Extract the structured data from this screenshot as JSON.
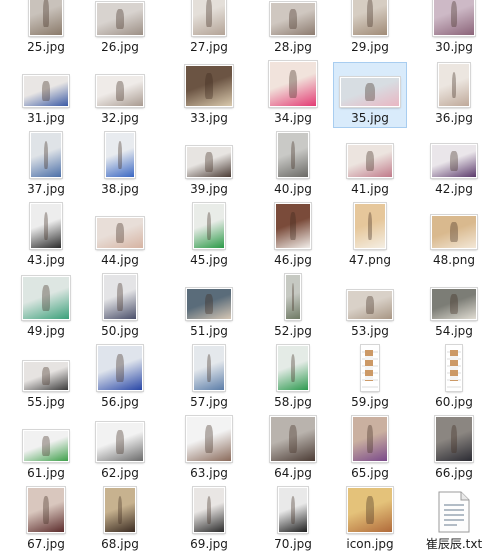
{
  "files": [
    {
      "name": "25.jpg",
      "colors": [
        "#c9c2bb",
        "#8a7a6a"
      ]
    },
    {
      "name": "26.jpg",
      "colors": [
        "#d8d3cf",
        "#9c8f85"
      ]
    },
    {
      "name": "27.jpg",
      "colors": [
        "#e4dfd9",
        "#b3a396"
      ]
    },
    {
      "name": "28.jpg",
      "colors": [
        "#cfc7c0",
        "#8c7b6f"
      ]
    },
    {
      "name": "29.jpg",
      "colors": [
        "#d6cdc2",
        "#a08b77"
      ]
    },
    {
      "name": "30.jpg",
      "colors": [
        "#cdb9c6",
        "#8b6479"
      ]
    },
    {
      "name": "31.jpg",
      "colors": [
        "#e9e6e4",
        "#3b5aa5"
      ]
    },
    {
      "name": "32.jpg",
      "colors": [
        "#efebe8",
        "#a89a90"
      ]
    },
    {
      "name": "33.jpg",
      "colors": [
        "#6b5443",
        "#d9c9ad"
      ]
    },
    {
      "name": "34.jpg",
      "colors": [
        "#f1e3dc",
        "#e33b74"
      ]
    },
    {
      "name": "35.jpg",
      "colors": [
        "#d7dde2",
        "#e9b6c2"
      ]
    },
    {
      "name": "36.jpg",
      "colors": [
        "#ece6e0",
        "#bfa99a"
      ]
    },
    {
      "name": "37.jpg",
      "colors": [
        "#dfe3e7",
        "#4b6fa8"
      ]
    },
    {
      "name": "38.jpg",
      "colors": [
        "#e8ebef",
        "#3a67c3"
      ]
    },
    {
      "name": "39.jpg",
      "colors": [
        "#e7e4e1",
        "#4a3b34"
      ]
    },
    {
      "name": "40.jpg",
      "colors": [
        "#c9c9c6",
        "#6b6a66"
      ]
    },
    {
      "name": "41.jpg",
      "colors": [
        "#ece4df",
        "#c07a8a"
      ]
    },
    {
      "name": "42.jpg",
      "colors": [
        "#eae6ea",
        "#5b3a6b"
      ]
    },
    {
      "name": "43.jpg",
      "colors": [
        "#ededed",
        "#2b2b2b"
      ]
    },
    {
      "name": "44.jpg",
      "colors": [
        "#e8ded8",
        "#d6b3a2"
      ]
    },
    {
      "name": "45.jpg",
      "colors": [
        "#e9ece8",
        "#2b9a47"
      ]
    },
    {
      "name": "46.jpg",
      "colors": [
        "#7a4b3a",
        "#f2eeea"
      ]
    },
    {
      "name": "47.png",
      "colors": [
        "#e6c79b",
        "#f4eee3"
      ]
    },
    {
      "name": "48.png",
      "colors": [
        "#d9b98e",
        "#f3e8d8"
      ]
    },
    {
      "name": "49.jpg",
      "colors": [
        "#dde6e2",
        "#3aa07a"
      ]
    },
    {
      "name": "50.jpg",
      "colors": [
        "#e4e4e6",
        "#4a4f6a"
      ]
    },
    {
      "name": "51.jpg",
      "colors": [
        "#5a6c7a",
        "#d6c7b5"
      ]
    },
    {
      "name": "52.jpg",
      "colors": [
        "#c6c9c2",
        "#6f7a65"
      ]
    },
    {
      "name": "53.jpg",
      "colors": [
        "#d9d1c8",
        "#a89684"
      ]
    },
    {
      "name": "54.jpg",
      "colors": [
        "#7c7d76",
        "#e1ddd3"
      ]
    },
    {
      "name": "55.jpg",
      "colors": [
        "#e6e3e1",
        "#3b3b3b"
      ]
    },
    {
      "name": "56.jpg",
      "colors": [
        "#dfe4ec",
        "#2846a6"
      ]
    },
    {
      "name": "57.jpg",
      "colors": [
        "#e4e8ec",
        "#5b7da8"
      ]
    },
    {
      "name": "58.jpg",
      "colors": [
        "#e4ebe6",
        "#2e9a4f"
      ]
    },
    {
      "name": "59.jpg",
      "colors": [
        "#ffffff",
        "#d06b3b"
      ],
      "doc": true
    },
    {
      "name": "60.jpg",
      "colors": [
        "#ffffff",
        "#b06b4b"
      ],
      "doc": true
    },
    {
      "name": "61.jpg",
      "colors": [
        "#f1f1f1",
        "#3ea04a"
      ]
    },
    {
      "name": "62.jpg",
      "colors": [
        "#f2f2f2",
        "#6a6a6a"
      ]
    },
    {
      "name": "63.jpg",
      "colors": [
        "#f3f3f3",
        "#8a6a5a"
      ]
    },
    {
      "name": "64.jpg",
      "colors": [
        "#b9b3ad",
        "#4b3b34"
      ]
    },
    {
      "name": "65.jpg",
      "colors": [
        "#cab0a0",
        "#7a4a8a"
      ]
    },
    {
      "name": "66.jpg",
      "colors": [
        "#8b8681",
        "#2b2b33"
      ]
    },
    {
      "name": "67.jpg",
      "colors": [
        "#d9c7be",
        "#5b2b2b"
      ]
    },
    {
      "name": "68.jpg",
      "colors": [
        "#c7b28f",
        "#3a2b22"
      ]
    },
    {
      "name": "69.jpg",
      "colors": [
        "#e9e6e4",
        "#2b2b2b"
      ]
    },
    {
      "name": "70.jpg",
      "colors": [
        "#e9e9e9",
        "#1f1f1f"
      ]
    },
    {
      "name": "icon.jpg",
      "colors": [
        "#e4c27a",
        "#b06a3a"
      ]
    },
    {
      "name": "崔辰辰.txt",
      "type": "txt"
    }
  ],
  "selected": "35.jpg"
}
